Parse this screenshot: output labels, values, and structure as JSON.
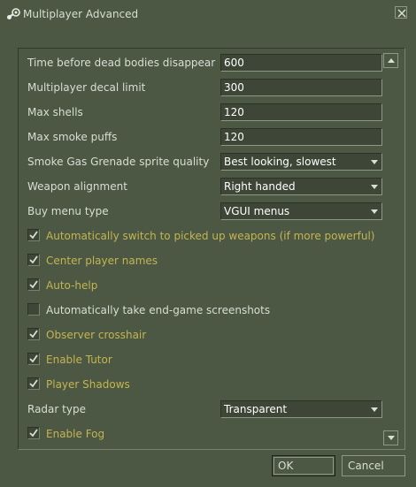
{
  "window": {
    "title": "Multiplayer Advanced",
    "title_icon": "steam-icon",
    "close_icon": "close-icon"
  },
  "colors": {
    "background": "#4c5844",
    "field_bg": "#3e4637",
    "checked_label": "#c4b550",
    "text": "#d8ded3"
  },
  "settings": [
    {
      "kind": "text",
      "label": "Time before dead bodies disappear",
      "value": "600"
    },
    {
      "kind": "text",
      "label": "Multiplayer decal limit",
      "value": "300"
    },
    {
      "kind": "text",
      "label": "Max shells",
      "value": "120"
    },
    {
      "kind": "text",
      "label": "Max smoke puffs",
      "value": "120"
    },
    {
      "kind": "select",
      "label": "Smoke Gas Grenade sprite quality",
      "value": "Best looking, slowest"
    },
    {
      "kind": "select",
      "label": "Weapon alignment",
      "value": "Right handed"
    },
    {
      "kind": "select",
      "label": "Buy menu type",
      "value": "VGUI menus"
    },
    {
      "kind": "checkbox",
      "label": "Automatically switch to picked up weapons (if more powerful)",
      "checked": true
    },
    {
      "kind": "checkbox",
      "label": "Center player names",
      "checked": true
    },
    {
      "kind": "checkbox",
      "label": "Auto-help",
      "checked": true
    },
    {
      "kind": "checkbox",
      "label": "Automatically take end-game screenshots",
      "checked": false
    },
    {
      "kind": "checkbox",
      "label": "Observer crosshair",
      "checked": true
    },
    {
      "kind": "checkbox",
      "label": "Enable Tutor",
      "checked": true
    },
    {
      "kind": "checkbox",
      "label": "Player Shadows",
      "checked": true
    },
    {
      "kind": "select",
      "label": "Radar type",
      "value": "Transparent"
    },
    {
      "kind": "checkbox",
      "label": "Enable Fog",
      "checked": true
    }
  ],
  "buttons": {
    "ok": "OK",
    "cancel": "Cancel"
  }
}
